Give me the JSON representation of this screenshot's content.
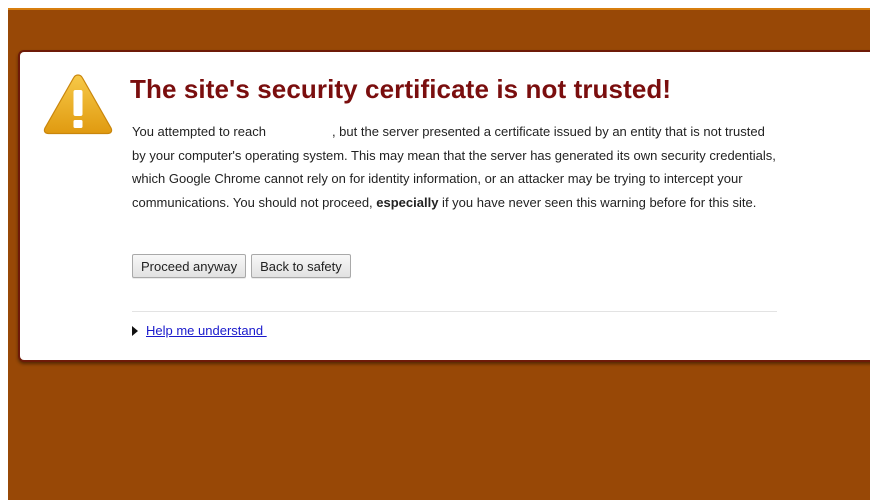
{
  "page": {
    "background_color": "#984806",
    "accent_color": "#d77e0f",
    "title_color": "#7a0e0e",
    "link_color": "#1a1acc"
  },
  "warning": {
    "icon": "warning-triangle-icon",
    "title": "The site's security certificate is not trusted!",
    "body_prefix": "You attempted to reach",
    "body_suffix": ", but the server presented a certificate issued by an entity that is not trusted by your computer's operating system. This may mean that the server has generated its own security credentials, which Google Chrome cannot rely on for identity information, or an attacker may be trying to intercept your communications. You should not proceed, ",
    "body_emphasis": "especially",
    "body_end": " if you have never seen this warning before for this site."
  },
  "buttons": {
    "proceed_label": "Proceed anyway",
    "back_label": "Back to safety"
  },
  "help": {
    "icon": "disclosure-arrow-icon",
    "label": "Help me understand "
  }
}
